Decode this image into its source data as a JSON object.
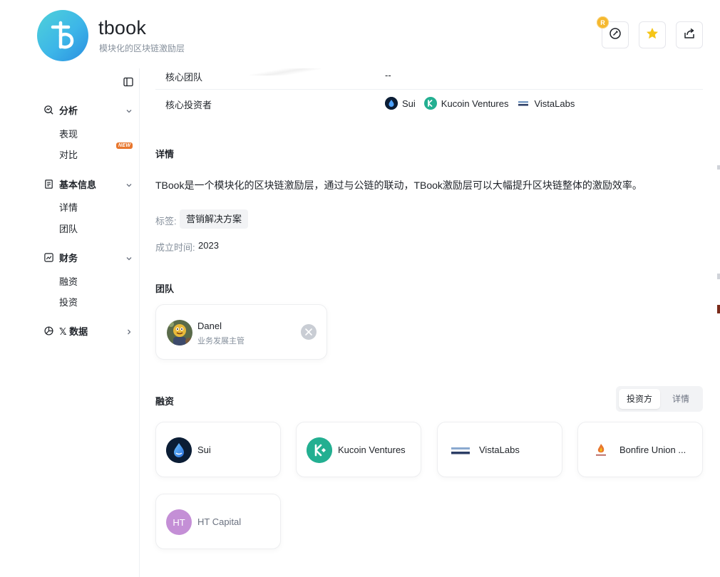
{
  "header": {
    "title": "tbook",
    "subtitle": "模块化的区块链激励层",
    "badge_letter": "R"
  },
  "sidebar": {
    "groups": [
      {
        "label": "分析",
        "icon": "analysis-icon",
        "items": [
          "表现",
          "对比"
        ],
        "new_badge": "NEW"
      },
      {
        "label": "基本信息",
        "icon": "info-doc-icon",
        "items": [
          "详情",
          "团队"
        ]
      },
      {
        "label": "财务",
        "icon": "finance-chart-icon",
        "items": [
          "融资",
          "投资"
        ]
      },
      {
        "label": "𝕏 数据",
        "icon": "pie-chart-icon",
        "items": []
      }
    ]
  },
  "details_table": {
    "rows": [
      {
        "key": "核心团队",
        "value": "--"
      },
      {
        "key": "核心投资者",
        "investors": [
          "Sui",
          "Kucoin Ventures",
          "VistaLabs"
        ]
      }
    ]
  },
  "details": {
    "title": "详情",
    "description": "TBook是一个模块化的区块链激励层，通过与公链的联动，TBook激励层可以大幅提升区块链整体的激励效率。",
    "tags_label": "标签:",
    "tags": [
      "营销解决方案"
    ],
    "founded_label": "成立时间:",
    "founded_value": "2023"
  },
  "team": {
    "title": "团队",
    "members": [
      {
        "name": "Danel",
        "role": "业务发展主管"
      }
    ]
  },
  "funding": {
    "title": "融资",
    "toggle": {
      "active": "投资方",
      "inactive": "详情"
    },
    "investors": [
      {
        "name": "Sui",
        "icon": "sui-logo-icon"
      },
      {
        "name": "Kucoin Ventures",
        "icon": "kucoin-logo-icon"
      },
      {
        "name": "VistaLabs",
        "icon": "vistalabs-logo-icon"
      },
      {
        "name": "Bonfire Union ...",
        "icon": "bonfire-logo-icon"
      },
      {
        "name": "HT Capital",
        "icon": "ht-initials-avatar",
        "initials": "HT"
      }
    ]
  },
  "colors": {
    "accent_orange": "#e8772e",
    "star_yellow": "#f5c518",
    "kucoin_green": "#23af91",
    "ht_purple": "#c48fd6"
  }
}
